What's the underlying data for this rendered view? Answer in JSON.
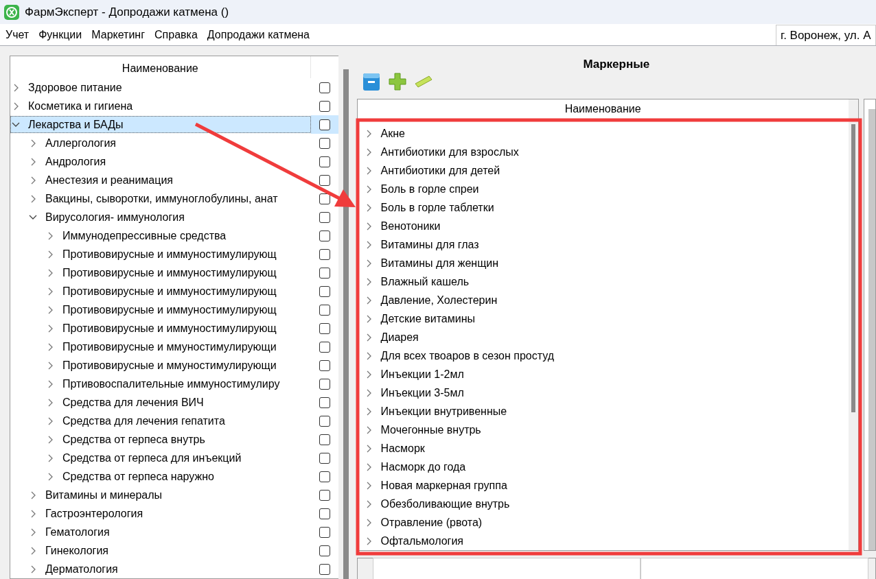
{
  "window": {
    "title": "ФармЭксперт - Допродажи катмена ()"
  },
  "menu": [
    "Учет",
    "Функции",
    "Маркетинг",
    "Справка",
    "Допродажи катмена"
  ],
  "address_field": {
    "value": "г. Воронеж, ул. А"
  },
  "category_tree": {
    "header": "Наименование",
    "items": [
      {
        "label": "Здоровое питание",
        "expanded": false,
        "selected": false,
        "checked": false
      },
      {
        "label": "Косметика и гигиена",
        "expanded": false,
        "selected": false,
        "checked": false
      },
      {
        "label": "Лекарства и БАДы",
        "expanded": true,
        "selected": true,
        "checked": false,
        "children": [
          {
            "label": "Аллергология",
            "expanded": false,
            "selected": false,
            "checked": false
          },
          {
            "label": "Андрология",
            "expanded": false,
            "selected": false,
            "checked": false
          },
          {
            "label": "Анестезия и реанимация",
            "expanded": false,
            "selected": false,
            "checked": false
          },
          {
            "label": "Вакцины, сыворотки, иммуноглобулины, анат",
            "expanded": false,
            "selected": false,
            "checked": false
          },
          {
            "label": "Вирусология- иммунология",
            "expanded": true,
            "selected": false,
            "checked": false,
            "children": [
              {
                "label": "Иммунодепрессивные средства",
                "expanded": false,
                "selected": false,
                "checked": false
              },
              {
                "label": "Противовирусные и иммуностимулирующ",
                "expanded": false,
                "selected": false,
                "checked": false
              },
              {
                "label": "Противовирусные и иммуностимулирующ",
                "expanded": false,
                "selected": false,
                "checked": false
              },
              {
                "label": "Противовирусные и иммуностимулирующ",
                "expanded": false,
                "selected": false,
                "checked": false
              },
              {
                "label": "Противовирусные и иммуностимулирующ",
                "expanded": false,
                "selected": false,
                "checked": false
              },
              {
                "label": "Противовирусные и иммуностимулирующ",
                "expanded": false,
                "selected": false,
                "checked": false
              },
              {
                "label": "Противовирусные и ммуностимулирующи",
                "expanded": false,
                "selected": false,
                "checked": false
              },
              {
                "label": "Противовирусные и ммуностимулирующи",
                "expanded": false,
                "selected": false,
                "checked": false
              },
              {
                "label": "Пртивовоспалительные иммуностимулиру",
                "expanded": false,
                "selected": false,
                "checked": false
              },
              {
                "label": "Средства для лечения ВИЧ",
                "expanded": false,
                "selected": false,
                "checked": false
              },
              {
                "label": "Средства для лечения гепатита",
                "expanded": false,
                "selected": false,
                "checked": false
              },
              {
                "label": "Средства от герпеса внутрь",
                "expanded": false,
                "selected": false,
                "checked": false
              },
              {
                "label": "Средства от герпеса для инъекций",
                "expanded": false,
                "selected": false,
                "checked": false
              },
              {
                "label": "Средства от герпеса наружно",
                "expanded": false,
                "selected": false,
                "checked": false
              }
            ]
          },
          {
            "label": "Витамины и минералы",
            "expanded": false,
            "selected": false,
            "checked": false
          },
          {
            "label": "Гастроэнтерология",
            "expanded": false,
            "selected": false,
            "checked": false
          },
          {
            "label": "Гематология",
            "expanded": false,
            "selected": false,
            "checked": false
          },
          {
            "label": "Гинекология",
            "expanded": false,
            "selected": false,
            "checked": false
          },
          {
            "label": "Дерматология",
            "expanded": false,
            "selected": false,
            "checked": false
          }
        ]
      }
    ]
  },
  "marker_panel": {
    "title": "Маркерные",
    "toolbar": [
      {
        "kind": "save"
      },
      {
        "kind": "add"
      },
      {
        "kind": "remove"
      }
    ],
    "header": "Наименование",
    "items": [
      {
        "label": "Акне",
        "expanded": false
      },
      {
        "label": "Антибиотики для взрослых",
        "expanded": false
      },
      {
        "label": "Антибиотики для детей",
        "expanded": false
      },
      {
        "label": "Боль в горле спреи",
        "expanded": false
      },
      {
        "label": "Боль в горле таблетки",
        "expanded": false
      },
      {
        "label": "Венотоники",
        "expanded": false
      },
      {
        "label": "Витамины для глаз",
        "expanded": false
      },
      {
        "label": "Витамины для женщин",
        "expanded": false
      },
      {
        "label": "Влажный кашель",
        "expanded": false
      },
      {
        "label": "Давление, Холестерин",
        "expanded": false
      },
      {
        "label": "Детские витамины",
        "expanded": false
      },
      {
        "label": "Диарея",
        "expanded": false
      },
      {
        "label": "Для всех твоаров в сезон простуд",
        "expanded": false
      },
      {
        "label": "Инъекции 1-2мл",
        "expanded": false
      },
      {
        "label": "Инъекции 3-5мл",
        "expanded": false
      },
      {
        "label": "Инъекции внутривенные",
        "expanded": false
      },
      {
        "label": "Мочегонные внутрь",
        "expanded": false
      },
      {
        "label": "Насморк",
        "expanded": false
      },
      {
        "label": "Насморк до года",
        "expanded": false
      },
      {
        "label": "Новая маркерная группа",
        "expanded": false
      },
      {
        "label": "Обезболивающие внутрь",
        "expanded": false
      },
      {
        "label": "Отравление (рвота)",
        "expanded": false
      },
      {
        "label": "Офтальмология",
        "expanded": false
      }
    ]
  },
  "annotations": {
    "arrow": true,
    "highlight_frame": true
  }
}
